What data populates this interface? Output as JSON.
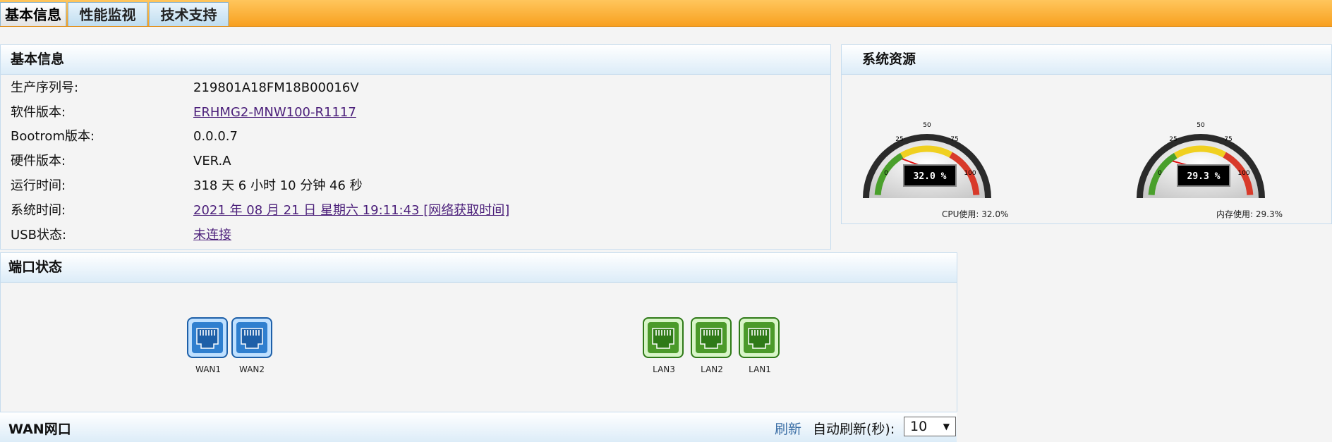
{
  "tabs": [
    {
      "label": "基本信息",
      "active": true
    },
    {
      "label": "性能监视",
      "active": false
    },
    {
      "label": "技术支持",
      "active": false
    }
  ],
  "basic_info": {
    "title": "基本信息",
    "rows": [
      {
        "label": "生产序列号:",
        "value": "219801A18FM18B00016V",
        "link": false
      },
      {
        "label": "软件版本:",
        "value": "ERHMG2-MNW100-R1117",
        "link": true
      },
      {
        "label": "Bootrom版本:",
        "value": "0.0.0.7",
        "link": false
      },
      {
        "label": "硬件版本:",
        "value": "VER.A",
        "link": false
      },
      {
        "label": "运行时间:",
        "value": "318 天 6 小时 10 分钟 46 秒",
        "link": false
      },
      {
        "label": "系统时间:",
        "value": "2021 年 08 月 21 日 星期六 19:11:43  [网络获取时间]",
        "link": true
      },
      {
        "label": "USB状态:",
        "value": "未连接",
        "link": true
      }
    ]
  },
  "system_resources": {
    "title": "系统资源",
    "gauges": [
      {
        "name": "cpu",
        "readout": "32.0 %",
        "caption": "CPU使用: 32.0%",
        "value": 32.0
      },
      {
        "name": "memory",
        "readout": "29.3 %",
        "caption": "内存使用: 29.3%",
        "value": 29.3
      }
    ],
    "scale_ticks": [
      "0",
      "25",
      "50",
      "75",
      "100"
    ]
  },
  "port_status": {
    "title": "端口状态",
    "wan_ports": [
      "WAN1",
      "WAN2"
    ],
    "lan_ports": [
      "LAN3",
      "LAN2",
      "LAN1"
    ]
  },
  "wan_section": {
    "title": "WAN网口",
    "refresh_label": "刷新",
    "auto_refresh_label": "自动刷新(秒):",
    "auto_refresh_value": "10"
  },
  "colors": {
    "tab_bar": "#f8a020",
    "panel_header": "#dcecf8",
    "wan_port": "#2f7fcf",
    "lan_port": "#4b9a2a",
    "link": "#4b1f7a",
    "refresh_link": "#3a6ea5"
  }
}
